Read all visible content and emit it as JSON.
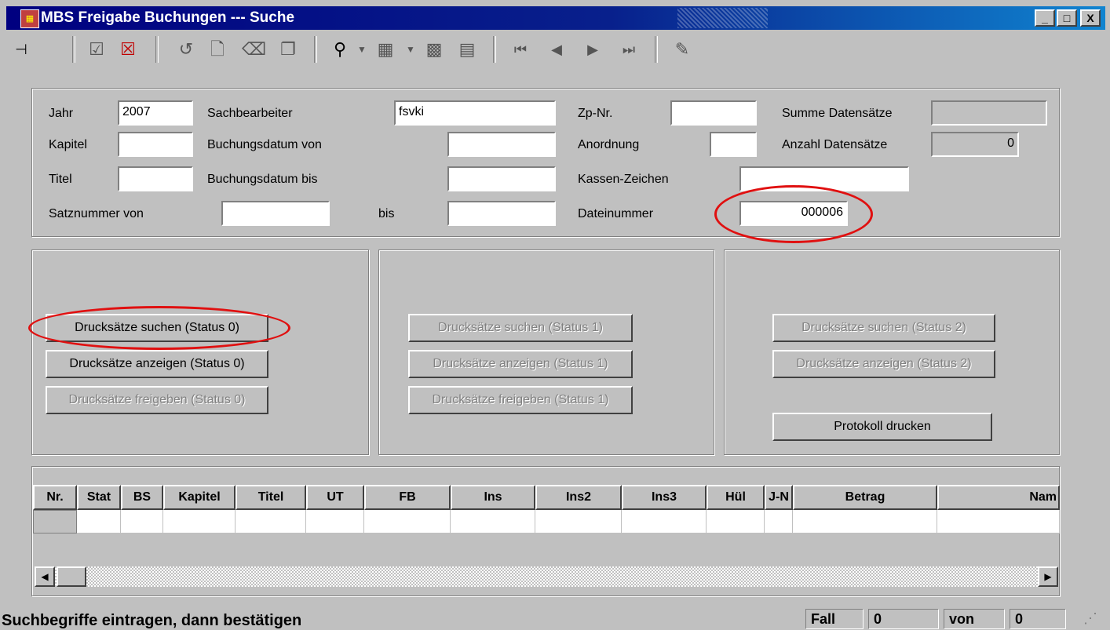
{
  "window": {
    "title": "MBS Freigabe Buchungen --- Suche",
    "controls": [
      "_",
      "□",
      "X"
    ]
  },
  "toolbar": {
    "icons": [
      "pin-icon",
      "edit-check-icon",
      "delete-record-icon",
      "undo-icon",
      "new-document-icon",
      "trash-icon",
      "copy-icon",
      "binoculars-icon",
      "grid-icon",
      "table-icon",
      "table-alt-icon",
      "first-record-icon",
      "previous-record-icon",
      "next-record-icon",
      "last-record-icon",
      "report-icon"
    ]
  },
  "search": {
    "jahr_label": "Jahr",
    "jahr_value": "2007",
    "kapitel_label": "Kapitel",
    "kapitel_value": "",
    "titel_label": "Titel",
    "titel_value": "",
    "satznummer_label": "Satznummer von",
    "satznummer_von_value": "",
    "bis_label": "bis",
    "bis_value": "",
    "sachbearbeiter_label": "Sachbearbeiter",
    "sachbearbeiter_value": "fsvki",
    "buchungsdatum_von_label": "Buchungsdatum von",
    "buchungsdatum_von_value": "",
    "buchungsdatum_bis_label": "Buchungsdatum bis",
    "buchungsdatum_bis_value": "",
    "zpnr_label": "Zp-Nr.",
    "zpnr_value": "",
    "anordnung_label": "Anordnung",
    "anordnung_value": "",
    "kassenzeichen_label": "Kassen-Zeichen",
    "kassenzeichen_value": "",
    "dateinummer_label": "Dateinummer",
    "dateinummer_value": "000006",
    "summe_label": "Summe Datensätze",
    "summe_value": "",
    "anzahl_label": "Anzahl Datensätze",
    "anzahl_value": "0"
  },
  "actions": {
    "status0": {
      "suchen": "Drucksätze suchen (Status 0)",
      "anzeigen": "Drucksätze anzeigen (Status 0)",
      "freigeben": "Drucksätze freigeben (Status 0)"
    },
    "status1": {
      "suchen": "Drucksätze suchen (Status 1)",
      "anzeigen": "Drucksätze anzeigen (Status 1)",
      "freigeben": "Drucksätze freigeben (Status 1)"
    },
    "status2": {
      "suchen": "Drucksätze suchen (Status 2)",
      "anzeigen": "Drucksätze anzeigen (Status 2)",
      "protokoll": "Protokoll drucken"
    }
  },
  "grid": {
    "columns": [
      "Nr.",
      "Stat",
      "BS",
      "Kapitel",
      "Titel",
      "UT",
      "FB",
      "Ins",
      "Ins2",
      "Ins3",
      "Hül",
      "J-N",
      "Betrag",
      "Nam"
    ]
  },
  "statusbar": {
    "message": "Suchbegriffe eintragen, dann bestätigen",
    "fall_label": "Fall",
    "fall_value": "0",
    "von_label": "von",
    "von_value": "0"
  },
  "colors": {
    "annotation": "#e01010",
    "titlebar": "#000080"
  }
}
